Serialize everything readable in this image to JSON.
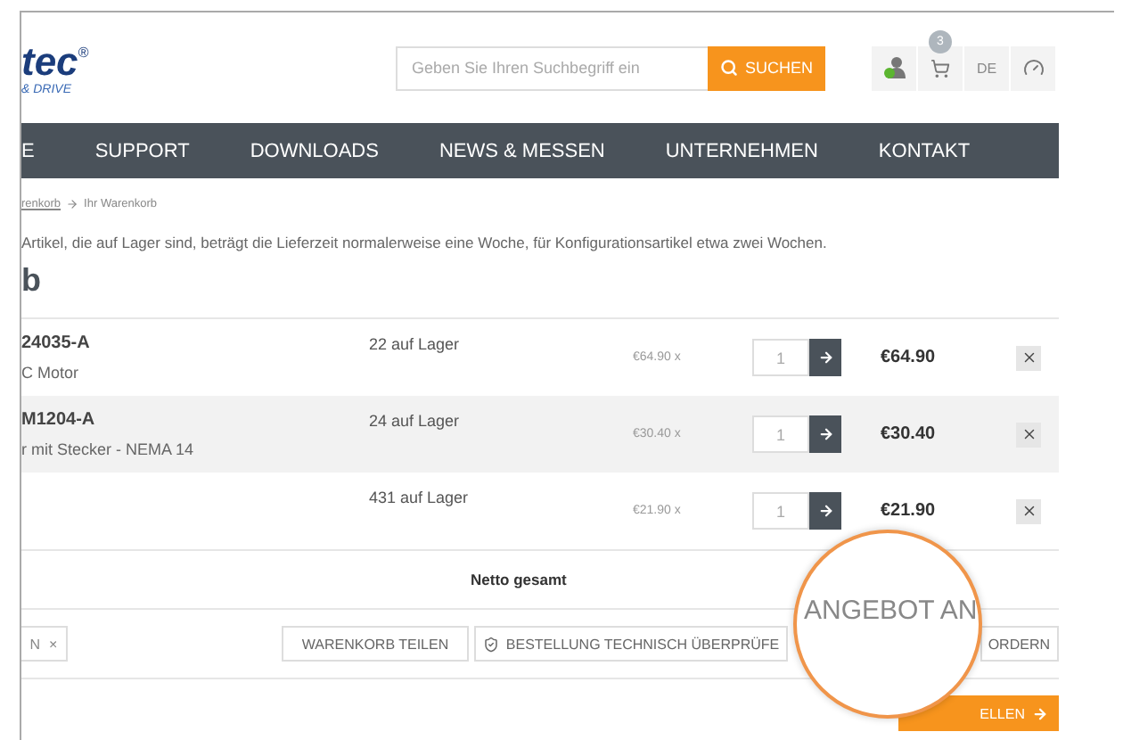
{
  "header": {
    "logo": {
      "name": "tec$^{®}$",
      "tagline": "& DRIVE"
    },
    "search": {
      "placeholder": "Geben Sie Ihren Suchbegriff ein",
      "button": "SUCHEN"
    },
    "cart_count": "3",
    "language": "DE"
  },
  "nav": [
    "E",
    "SUPPORT",
    "DOWNLOADS",
    "NEWS & MESSEN",
    "UNTERNEHMEN",
    "KONTAKT"
  ],
  "breadcrumb": {
    "link": "renkorb",
    "current": "Ihr Warenkorb"
  },
  "notice": "Artikel, die auf Lager sind, beträgt die Lieferzeit normalerweise eine Woche, für Konfigurationsartikel etwa zwei Wochen.",
  "heading": "b",
  "cart": [
    {
      "sku": "24035-A",
      "description": "C Motor",
      "stock": "22 auf Lager",
      "unit_price": "€64.90",
      "per": "x",
      "qty": "1",
      "total": "€64.90",
      "shaded": false
    },
    {
      "sku": "M1204-A",
      "description": "r mit Stecker - NEMA 14",
      "stock": "24 auf Lager",
      "unit_price": "€30.40",
      "per": "x",
      "qty": "1",
      "total": "€30.40",
      "shaded": true
    },
    {
      "stock": "431 auf Lager",
      "unit_price": "€21.90",
      "per": "x",
      "qty": "1",
      "total": "€21.90",
      "shaded": false
    }
  ],
  "net_total_label": "Netto gesamt",
  "coupon_tag": {
    "label": "N",
    "remove": "×"
  },
  "actions": {
    "share": "WARENKORB TEILEN",
    "review": "BESTELLUNG TECHNISCH ÜBERPRÜFE",
    "quote": "ORDERN"
  },
  "order_button": "ELLEN",
  "magnifier": {
    "text": "ANGEBOT AN"
  }
}
